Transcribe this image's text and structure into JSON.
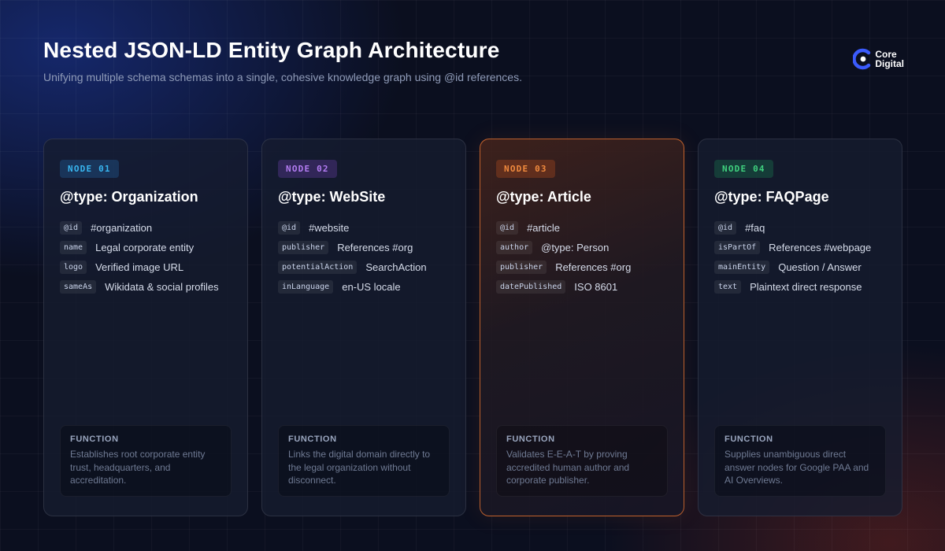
{
  "header": {
    "title": "Nested JSON-LD Entity Graph Architecture",
    "subtitle": "Unifying multiple schema schemas into a single, cohesive knowledge graph using @id references."
  },
  "brand": {
    "line1": "Core",
    "line2": "Digital",
    "icon": "c-logo-icon",
    "color": "#3b5bfd"
  },
  "cards": [
    {
      "badge": "NODE 01",
      "accent": "#38b6f0",
      "type": "@type: Organization",
      "props": [
        {
          "key": "@id",
          "value": "#organization"
        },
        {
          "key": "name",
          "value": "Legal corporate entity"
        },
        {
          "key": "logo",
          "value": "Verified image URL"
        },
        {
          "key": "sameAs",
          "value": "Wikidata & social profiles"
        }
      ],
      "function_label": "FUNCTION",
      "function_text": "Establishes root corporate entity trust, headquarters, and accreditation."
    },
    {
      "badge": "NODE 02",
      "accent": "#b37cf2",
      "type": "@type: WebSite",
      "props": [
        {
          "key": "@id",
          "value": "#website"
        },
        {
          "key": "publisher",
          "value": "References #org"
        },
        {
          "key": "potentialAction",
          "value": "SearchAction"
        },
        {
          "key": "inLanguage",
          "value": "en-US locale"
        }
      ],
      "function_label": "FUNCTION",
      "function_text": "Links the digital domain directly to the legal organization without disconnect."
    },
    {
      "badge": "NODE 03",
      "accent": "#f08a3e",
      "type": "@type: Article",
      "props": [
        {
          "key": "@id",
          "value": "#article"
        },
        {
          "key": "author",
          "value": "@type: Person"
        },
        {
          "key": "publisher",
          "value": "References #org"
        },
        {
          "key": "datePublished",
          "value": "ISO 8601"
        }
      ],
      "function_label": "FUNCTION",
      "function_text": "Validates E-E-A-T by proving accredited human author and corporate publisher."
    },
    {
      "badge": "NODE 04",
      "accent": "#3fd07e",
      "type": "@type: FAQPage",
      "props": [
        {
          "key": "@id",
          "value": "#faq"
        },
        {
          "key": "isPartOf",
          "value": "References #webpage"
        },
        {
          "key": "mainEntity",
          "value": "Question / Answer"
        },
        {
          "key": "text",
          "value": "Plaintext direct response"
        }
      ],
      "function_label": "FUNCTION",
      "function_text": "Supplies unambiguous direct answer nodes for Google PAA and AI Overviews."
    }
  ]
}
